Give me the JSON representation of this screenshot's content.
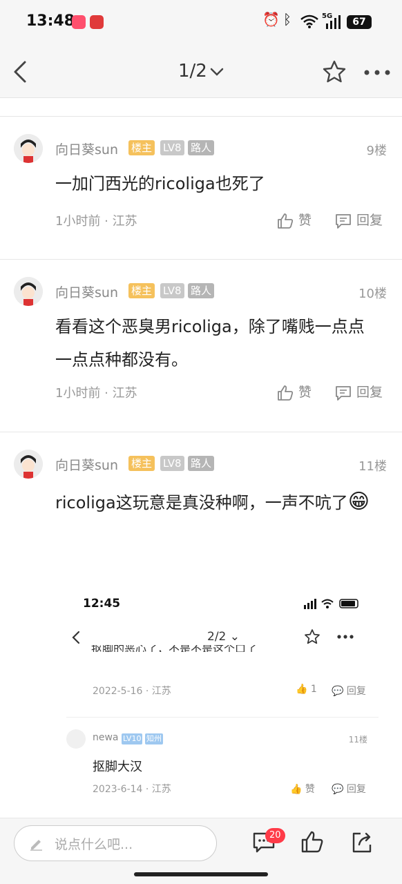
{
  "status_bar": {
    "time": "13:48",
    "battery": "67",
    "network": "5G"
  },
  "header": {
    "page_indicator": "1/2"
  },
  "posts": [
    {
      "username": "向日葵sun",
      "host_badge": "楼主",
      "level": "LV8",
      "tag": "路人",
      "floor": "9楼",
      "content": "一加门西光的ricoliga也死了",
      "time_location": "1小时前 · 江苏",
      "like_label": "赞",
      "reply_label": "回复"
    },
    {
      "username": "向日葵sun",
      "host_badge": "楼主",
      "level": "LV8",
      "tag": "路人",
      "floor": "10楼",
      "content": "看看这个恶臭男ricoliga，除了嘴贱一点点一点点种都没有。",
      "time_location": "1小时前 · 江苏",
      "like_label": "赞",
      "reply_label": "回复"
    },
    {
      "username": "向日葵sun",
      "host_badge": "楼主",
      "level": "LV8",
      "tag": "路人",
      "floor": "11楼",
      "content": "ricoliga这玩意是真没种啊，一声不吭了",
      "emoji": "😁"
    }
  ],
  "embedded_screenshot": {
    "time": "12:45",
    "page_indicator": "2/2",
    "cut_text": "抠脚的恶心了，不是不是这个口了",
    "prev_meta": {
      "date_location": "2022-5-16 · 江苏",
      "like_count": "1",
      "reply_label": "回复"
    },
    "reply": {
      "username": "newa",
      "level": "LV10",
      "tag": "知州",
      "floor": "11楼",
      "content": "抠脚大汉",
      "date_location": "2023-6-14 · 江苏",
      "like_label": "赞",
      "reply_label": "回复"
    }
  },
  "bottom_bar": {
    "input_placeholder": "说点什么吧...",
    "comment_count": "20"
  },
  "colors": {
    "host_badge": "#f5c15c",
    "level_badge": "#c8c8c8",
    "tag_badge": "#b5b5b5",
    "count_badge": "#ff3b48"
  }
}
